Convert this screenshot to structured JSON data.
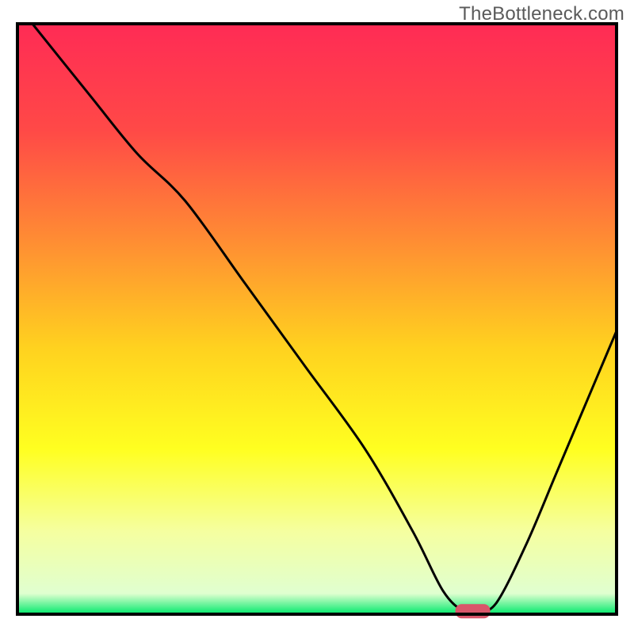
{
  "watermark": "TheBottleneck.com",
  "chart_data": {
    "type": "line",
    "title": "",
    "xlabel": "",
    "ylabel": "",
    "xlim": [
      0,
      100
    ],
    "ylim": [
      0,
      100
    ],
    "grid": false,
    "legend": false,
    "background": {
      "type": "vertical-gradient",
      "stops": [
        {
          "pos": 0.0,
          "color": "#ff2b55"
        },
        {
          "pos": 0.18,
          "color": "#ff4947"
        },
        {
          "pos": 0.36,
          "color": "#ff8a34"
        },
        {
          "pos": 0.55,
          "color": "#ffd21f"
        },
        {
          "pos": 0.72,
          "color": "#ffff20"
        },
        {
          "pos": 0.86,
          "color": "#f5ffa0"
        },
        {
          "pos": 0.965,
          "color": "#e0ffd0"
        },
        {
          "pos": 1.0,
          "color": "#00e96b"
        }
      ]
    },
    "series": [
      {
        "name": "bottleneck-curve",
        "color": "#000000",
        "x": [
          2.5,
          12,
          20,
          28,
          38,
          48,
          58,
          66,
          71,
          74.5,
          77,
          80,
          85,
          90,
          95,
          100
        ],
        "y": [
          100,
          88,
          78,
          70,
          56,
          42,
          28,
          14,
          4,
          0.5,
          0.5,
          2,
          12,
          24,
          36,
          48
        ]
      }
    ],
    "marker": {
      "name": "optimal-point",
      "x": 76,
      "y": 0.5,
      "color": "#d9566a",
      "shape": "rounded-pill"
    },
    "frame": {
      "color": "#000000",
      "width": 4
    }
  }
}
